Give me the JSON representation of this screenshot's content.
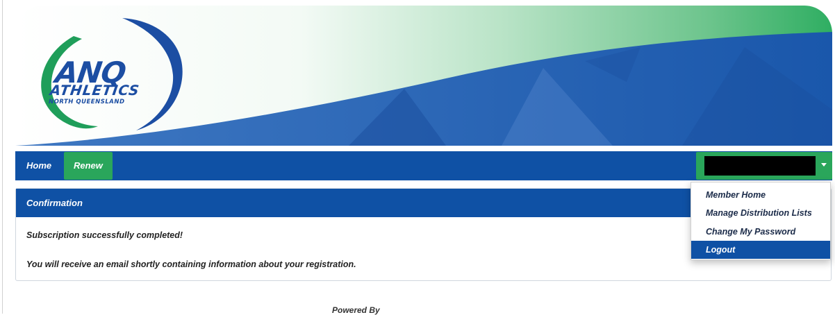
{
  "logo": {
    "name": "ANQ",
    "line2": "ATHLETICS",
    "line3": "NORTH QUEENSLAND"
  },
  "nav": {
    "home_label": "Home",
    "renew_label": "Renew",
    "user_name": ""
  },
  "panel": {
    "title": "Confirmation",
    "message1": "Subscription successfully completed!",
    "message2": "You will receive an email shortly containing information about your registration."
  },
  "user_dropdown": {
    "items": [
      {
        "label": "Member Home"
      },
      {
        "label": "Manage Distribution Lists"
      },
      {
        "label": "Change My Password"
      },
      {
        "label": "Logout"
      }
    ]
  },
  "footer": {
    "powered_by": "Powered By"
  },
  "colors": {
    "navy": "#0f51a5",
    "green": "#2aa65b"
  }
}
